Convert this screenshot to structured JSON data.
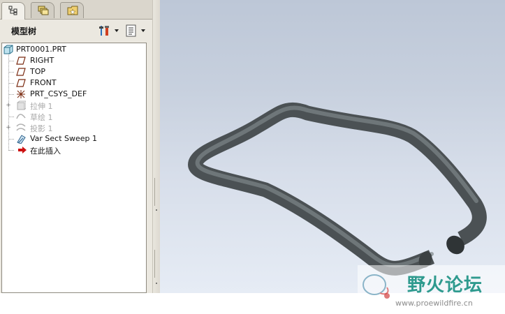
{
  "tabs": [
    {
      "name": "model-tree-tab",
      "icon": "model-tree-icon",
      "active": true
    },
    {
      "name": "layers-tab",
      "icon": "layers-icon",
      "active": false
    },
    {
      "name": "favorites-tab",
      "icon": "folder-star-icon",
      "active": false
    }
  ],
  "panel": {
    "title": "模型树",
    "settings_icon": "tools-icon",
    "show_icon": "list-icon"
  },
  "tree": {
    "root": "PRT0001.PRT",
    "items": [
      {
        "label": "RIGHT",
        "icon": "datum-plane-icon",
        "dim": false,
        "expandable": false
      },
      {
        "label": "TOP",
        "icon": "datum-plane-icon",
        "dim": false,
        "expandable": false
      },
      {
        "label": "FRONT",
        "icon": "datum-plane-icon",
        "dim": false,
        "expandable": false
      },
      {
        "label": "PRT_CSYS_DEF",
        "icon": "csys-icon",
        "dim": false,
        "expandable": false
      },
      {
        "label": "拉伸 1",
        "icon": "extrude-icon",
        "dim": true,
        "expandable": true
      },
      {
        "label": "草绘 1",
        "icon": "sketch-icon",
        "dim": true,
        "expandable": false
      },
      {
        "label": "投影 1",
        "icon": "projection-icon",
        "dim": true,
        "expandable": true
      },
      {
        "label": "Var Sect Sweep 1",
        "icon": "sweep-icon",
        "dim": false,
        "expandable": false
      },
      {
        "label": "在此插入",
        "icon": "insert-arrow-icon",
        "dim": false,
        "expandable": false
      }
    ]
  },
  "watermark": {
    "text": "野火论坛",
    "url": "www.proewildfire.cn"
  },
  "colors": {
    "viewport_top": "#bdc7d7",
    "viewport_bottom": "#e6ecf5",
    "insert_arrow": "#cc1111",
    "watermark_text": "#2e9a8e"
  }
}
